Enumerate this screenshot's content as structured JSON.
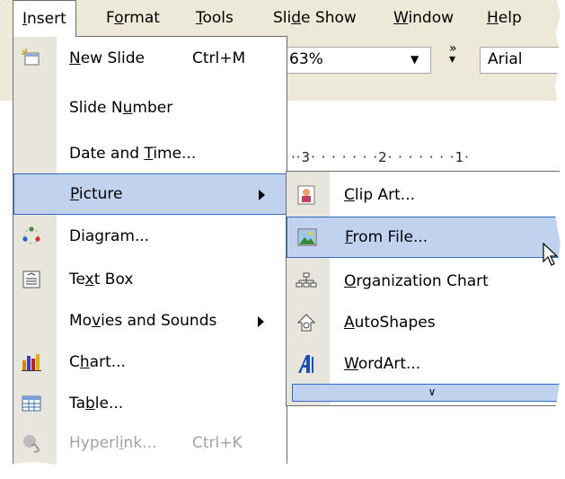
{
  "menubar": {
    "items": [
      {
        "label": "Insert",
        "active": true
      },
      {
        "label": "Format"
      },
      {
        "label": "Tools"
      },
      {
        "label": "Slide Show"
      },
      {
        "label": "Window"
      },
      {
        "label": "Help"
      }
    ]
  },
  "toolbar": {
    "zoom_value": "63%",
    "font_value": "Arial"
  },
  "ruler": {
    "text": "··3· · · · · · ·2· · · · · · ·1·"
  },
  "insert_menu": {
    "items": [
      {
        "label": "New Slide",
        "shortcut": "Ctrl+M",
        "icon": "new-slide-icon"
      },
      {
        "label": "Slide Number"
      },
      {
        "label": "Date and Time..."
      },
      {
        "label": "Picture",
        "submenu": true,
        "highlighted": true
      },
      {
        "label": "Diagram...",
        "icon": "diagram-icon"
      },
      {
        "label": "Text Box",
        "icon": "text-box-icon"
      },
      {
        "label": "Movies and Sounds",
        "submenu": true
      },
      {
        "label": "Chart...",
        "icon": "chart-icon"
      },
      {
        "label": "Table...",
        "icon": "table-icon"
      },
      {
        "label": "Hyperlink...",
        "shortcut": "Ctrl+K",
        "disabled": true,
        "icon": "hyperlink-icon"
      }
    ]
  },
  "picture_submenu": {
    "items": [
      {
        "label": "Clip Art...",
        "icon": "clip-art-icon"
      },
      {
        "label": "From File...",
        "icon": "from-file-icon",
        "highlighted": true
      },
      {
        "label": "Organization Chart",
        "icon": "organization-chart-icon"
      },
      {
        "label": "AutoShapes",
        "icon": "autoshapes-icon"
      },
      {
        "label": "WordArt...",
        "icon": "wordart-icon"
      }
    ],
    "expand_glyph": "»"
  },
  "colors": {
    "highlight_fill": "#c1d2ee",
    "highlight_border": "#316ac5",
    "menubar_bg": "#ece9d8",
    "disabled_text": "#a3a3a3"
  }
}
